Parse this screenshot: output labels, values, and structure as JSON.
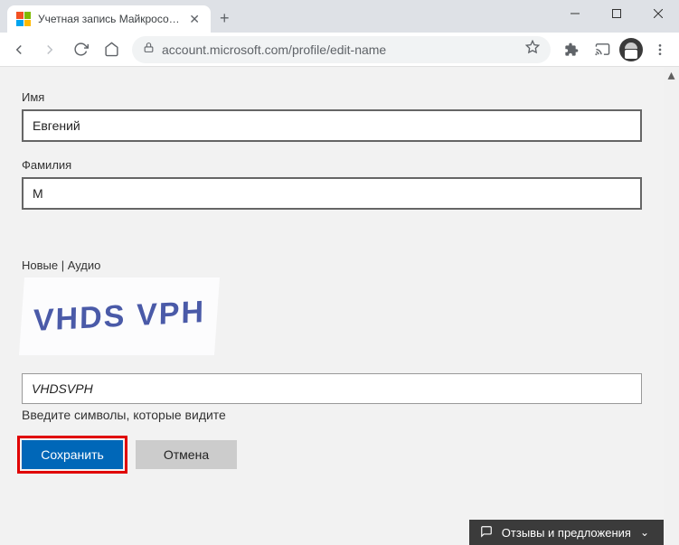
{
  "tab": {
    "title": "Учетная запись Майкрософт | В"
  },
  "url": "account.microsoft.com/profile/edit-name",
  "form": {
    "first_name_label": "Имя",
    "first_name_value": "Евгений",
    "last_name_label": "Фамилия",
    "last_name_value": "М",
    "captcha_links": "Новые | Аудио",
    "captcha_image_text": "VHDS VPH",
    "captcha_value": "VHDSVPH",
    "captcha_hint": "Введите символы, которые видите",
    "save_label": "Сохранить",
    "cancel_label": "Отмена"
  },
  "feedback": {
    "label": "Отзывы и предложения"
  }
}
